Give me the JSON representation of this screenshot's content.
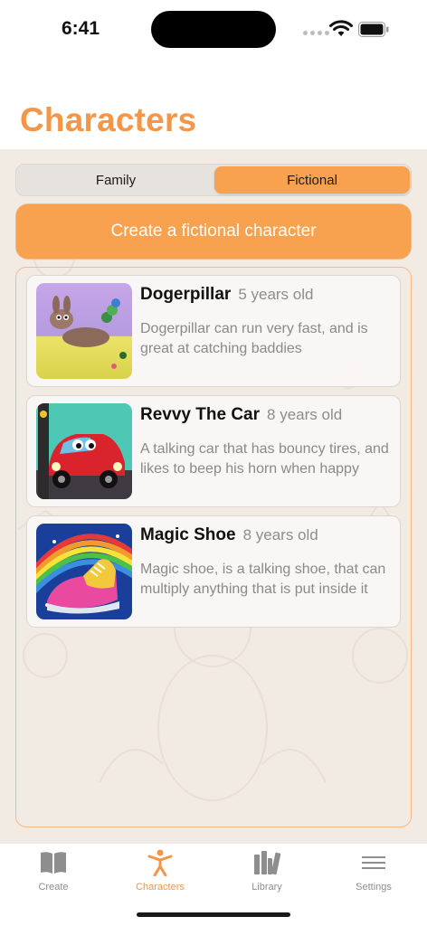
{
  "status": {
    "time": "6:41"
  },
  "page": {
    "title": "Characters"
  },
  "segmented": {
    "family": "Family",
    "fictional": "Fictional",
    "selected": "Fictional"
  },
  "create_button": {
    "label": "Create a fictional character"
  },
  "characters": [
    {
      "name": "Dogerpillar",
      "age": "5 years old",
      "description": "Dogerpillar can run very fast, and is great at catching baddies",
      "image_icon": "dog-caterpillar-illustration"
    },
    {
      "name": "Revvy The Car",
      "age": "8 years old",
      "description": "A talking car that has bouncy tires, and likes to beep his horn when happy",
      "image_icon": "red-car-illustration"
    },
    {
      "name": "Magic Shoe",
      "age": "8 years old",
      "description": "Magic shoe, is a talking shoe, that can multiply anything that is put inside it",
      "image_icon": "rainbow-shoe-illustration"
    }
  ],
  "tabs": [
    {
      "label": "Create",
      "icon": "book-icon"
    },
    {
      "label": "Characters",
      "icon": "person-icon",
      "active": true
    },
    {
      "label": "Library",
      "icon": "books-icon"
    },
    {
      "label": "Settings",
      "icon": "menu-icon"
    }
  ],
  "colors": {
    "accent": "#f8a14f",
    "title": "#f4964a",
    "background": "#f1ebe4"
  }
}
